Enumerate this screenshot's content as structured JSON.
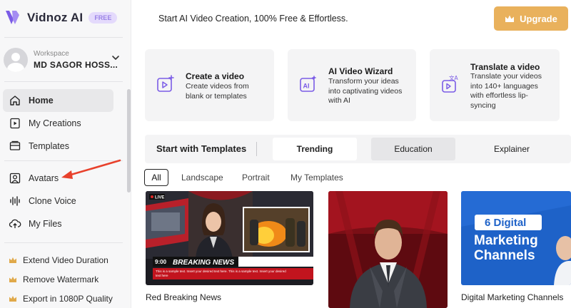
{
  "app": {
    "name": "Vidnoz AI",
    "badge": "FREE"
  },
  "workspace": {
    "label": "Workspace",
    "name": "MD SAGOR HOSS..."
  },
  "nav": {
    "home": "Home",
    "my_creations": "My Creations",
    "templates": "Templates",
    "avatars": "Avatars",
    "clone_voice": "Clone Voice",
    "my_files": "My Files"
  },
  "promos": {
    "extend": "Extend Video Duration",
    "watermark": "Remove Watermark",
    "export": "Export in 1080P Quality"
  },
  "header": {
    "tagline": "Start AI Video Creation, 100% Free & Effortless.",
    "upgrade_label": "Upgrade"
  },
  "cards": {
    "create": {
      "title": "Create a video",
      "desc_1": "Create videos from",
      "desc_2": "blank or templates"
    },
    "wizard": {
      "title": "AI Video Wizard",
      "desc_1": "Transform your ideas",
      "desc_2": "into captivating videos",
      "desc_3": "with AI"
    },
    "translate": {
      "title": "Translate a video",
      "desc_1": "Translate your videos",
      "desc_2": "into 140+ languages",
      "desc_3": "with effortless lip-",
      "desc_4": "syncing"
    }
  },
  "templates": {
    "title": "Start with Templates",
    "tabs": {
      "trending": "Trending",
      "education": "Education",
      "explainer": "Explainer"
    },
    "filters": {
      "all": "All",
      "landscape": "Landscape",
      "portrait": "Portrait",
      "my_templates": "My Templates"
    },
    "items": {
      "news": {
        "caption": "Red Breaking News",
        "live": "LIVE",
        "time": "9:00",
        "headline": "BREAKING NEWS",
        "ticker": "This is a sample text. Insert your desired text here. This is a sample text. Insert your desired text here"
      },
      "marketing": {
        "caption": "Digital Marketing Channels",
        "line_1": "6 Digital",
        "line_2": "Marketing",
        "line_3": "Channels"
      }
    }
  },
  "colors": {
    "accent_purple": "#7b5ce6",
    "upgrade_orange": "#e9b15c",
    "annotation_red": "#e8412c",
    "crown_gold": "#e0a94a"
  }
}
